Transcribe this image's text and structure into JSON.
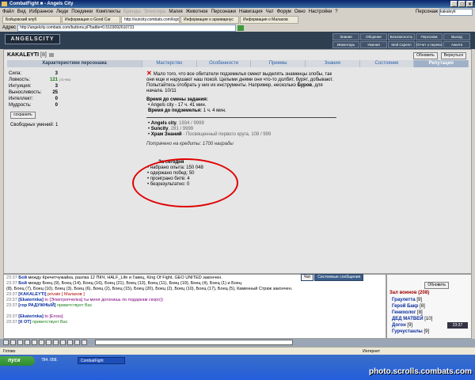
{
  "window": {
    "title": "CombatFight ■ - Angels City"
  },
  "menu": {
    "items": [
      "Файл",
      "Вид",
      "Избранное",
      "Люди",
      "Поединки",
      "Комплекты"
    ],
    "disabled": [
      "Бренды",
      "Элексиры"
    ],
    "items2": [
      "Магия",
      "Животное",
      "Персонажи",
      "Навигация",
      "Чат",
      "Форум",
      "Окно",
      "Настройки",
      "?"
    ],
    "persona_label": "Персонаж",
    "persona_value": "kakaleyti"
  },
  "browser_tabs": [
    "Бойцовский клуб",
    "Информация о Good Car",
    "http://suncity.combats.com/logo.pl?lo",
    "Информация о архиварнус",
    "Информация о Малахов"
  ],
  "address": {
    "label": "Адрес",
    "url": "http://angelcity.combats.com/buttons.pl?battle=0.5103092610731"
  },
  "site": {
    "logo": "ANGELSCITY",
    "topnav": [
      "Знания",
      "Общение",
      "Безопасность",
      "Персонаж",
      "Выход",
      "Инвентарь",
      "Умения",
      "Мой Скрепл",
      "Отчет о переводе",
      "Анкета"
    ]
  },
  "character": {
    "name": "KAKALEYTI",
    "level": "[8]",
    "buttons": {
      "refresh": "Обновить",
      "back": "Вернуться"
    }
  },
  "tabs": [
    "Характеристики персонажа",
    "Мастерство",
    "Особенности",
    "Приемы",
    "Знания",
    "Состояние",
    "Репутация"
  ],
  "stats": [
    {
      "name": "Сила:",
      "value": "3",
      "extra": ""
    },
    {
      "name": "Ловкость:",
      "value": "121",
      "extra": "(71+50)"
    },
    {
      "name": "Интуиция:",
      "value": "3",
      "extra": ""
    },
    {
      "name": "Выносливость:",
      "value": "25",
      "extra": ""
    },
    {
      "name": "Интеллект:",
      "value": "0",
      "extra": ""
    },
    {
      "name": "Мудрость:",
      "value": "0",
      "extra": ""
    }
  ],
  "save_button": "сохранить",
  "free_skills": "Свободных умений: 1",
  "quest": {
    "text": "Мало того, что все обитатели подземелья смеют выделять знаменцы злобы, так они еще и нарушают наш покой. Целыми днями они что-то долбят, бурят, добывают. Попытайтесь отобрать у них их инструменты. Например, несколько",
    "target": "Буров",
    "tail": ", для начала. 10/11"
  },
  "quest_time": {
    "title": "Время до смены задания:",
    "items": [
      "Angels city - 17 ч. 41 мин."
    ],
    "dungeon_label": "Время до подземелья:",
    "dungeon_value": "1 ч. 4 мин."
  },
  "reputation": [
    {
      "name": "Angels city",
      "value": ", 1934 / 9999"
    },
    {
      "name": "Suncity",
      "value": ", 281 / 9999"
    },
    {
      "name": "Храм Знаний",
      "value": " - Посвященный первого круга, 108 / 999"
    }
  ],
  "spent": {
    "label": "Потрачено на кредиты:",
    "value": "1700 награды"
  },
  "today": {
    "title": "За сегодня",
    "items": [
      "набрано опыта: 150 048",
      "одержано побед: 50",
      "проиграно битв: 4",
      "безрезультатно: 0"
    ]
  },
  "chat_tabs": {
    "chat": "Чат",
    "system": "Системные сообщения"
  },
  "chat": [
    {
      "time": "23:37",
      "nick": "Бой",
      "text": " между Кречетчужайка, разлка 12 ПКЧ, HALF_Life и Гавец, King Of Fight, GEO UNITED закончен."
    },
    {
      "time": "23:37",
      "nick": "Бой",
      "text": " между Боец (9), Боец (14), Боец (16), Боец (21), Боец (13), Боец (11), Боец (19), Боец (4), Боец (1) и Боец"
    },
    {
      "time": "",
      "nick": "",
      "text": "(8), Боец (7), Боец (10), Боец (3), Боец (6), Боец (2), Боец (15), Боец (20), Боец (2), Боец (10), Боец (17), Боец (5), Каменный Страж закончен."
    },
    {
      "time": "23:37",
      "nick": "[KAKALEYTI]",
      "text": " private [ Малахов ]",
      "cls": "red"
    },
    {
      "time": "23:37",
      "nick": "[Ekaterinka]",
      "text": " to [Электропчелка] ты меня догонишь по подаркам скоро))",
      "cls": "purple"
    },
    {
      "time": "23:37",
      "nick": "[гор РАДУЖНЫЙ]",
      "text": " приветствует Вас"
    },
    {
      "time": "",
      "nick": "",
      "text": ""
    },
    {
      "time": "23:37",
      "nick": "[Ekaterinka]",
      "text": " to [Eross]",
      "cls": "purple"
    },
    {
      "time": "23:37",
      "nick": "[К ОТ]",
      "text": " приветствует Вас"
    }
  ],
  "room": {
    "refresh": "Обновить",
    "title": "Зал воинов (208)",
    "users": [
      {
        "name": "Граулетта",
        "lvl": "[9]"
      },
      {
        "name": "Герой Бакр",
        "lvl": "[8]"
      },
      {
        "name": "Генихолог",
        "lvl": "[8]"
      },
      {
        "name": "ДЕД МАТВЕЙ",
        "lvl": "[10]"
      },
      {
        "name": "Догон",
        "lvl": "[9]"
      },
      {
        "name": "Гурчустанлы",
        "lvl": "[9]"
      }
    ],
    "clock": "23:37"
  },
  "status": {
    "text": "Готово",
    "zone": "Интернет"
  },
  "taskbar": {
    "start": "пуск",
    "item": "CombatFight",
    "tray": "784. 058."
  },
  "watermark": "photo.scrolls.combats.com"
}
